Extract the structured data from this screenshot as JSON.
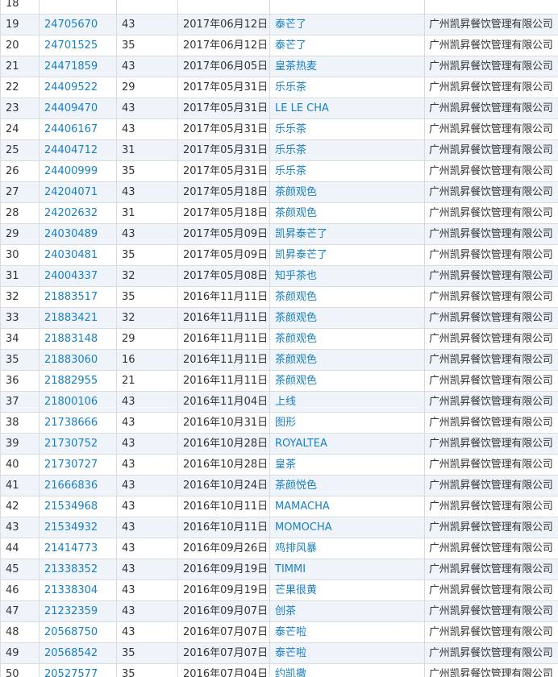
{
  "table": {
    "rows": [
      {
        "no": "18",
        "reg": "",
        "cls": "",
        "date": "",
        "name": "",
        "applicant": ""
      },
      {
        "no": "19",
        "reg": "24705670",
        "cls": "43",
        "date": "2017年06月12日",
        "name": "泰芒了",
        "applicant": "广州凯昇餐饮管理有限公司"
      },
      {
        "no": "20",
        "reg": "24701525",
        "cls": "35",
        "date": "2017年06月12日",
        "name": "泰芒了",
        "applicant": "广州凯昇餐饮管理有限公司"
      },
      {
        "no": "21",
        "reg": "24471859",
        "cls": "43",
        "date": "2017年06月05日",
        "name": "皇茶热麦",
        "applicant": "广州凯昇餐饮管理有限公司"
      },
      {
        "no": "22",
        "reg": "24409522",
        "cls": "29",
        "date": "2017年05月31日",
        "name": "乐乐茶",
        "applicant": "广州凯昇餐饮管理有限公司"
      },
      {
        "no": "23",
        "reg": "24409470",
        "cls": "43",
        "date": "2017年05月31日",
        "name": "LE LE CHA",
        "applicant": "广州凯昇餐饮管理有限公司"
      },
      {
        "no": "24",
        "reg": "24406167",
        "cls": "43",
        "date": "2017年05月31日",
        "name": "乐乐茶",
        "applicant": "广州凯昇餐饮管理有限公司"
      },
      {
        "no": "25",
        "reg": "24404712",
        "cls": "31",
        "date": "2017年05月31日",
        "name": "乐乐茶",
        "applicant": "广州凯昇餐饮管理有限公司"
      },
      {
        "no": "26",
        "reg": "24400999",
        "cls": "35",
        "date": "2017年05月31日",
        "name": "乐乐茶",
        "applicant": "广州凯昇餐饮管理有限公司"
      },
      {
        "no": "27",
        "reg": "24204071",
        "cls": "43",
        "date": "2017年05月18日",
        "name": "茶颜观色",
        "applicant": "广州凯昇餐饮管理有限公司"
      },
      {
        "no": "28",
        "reg": "24202632",
        "cls": "31",
        "date": "2017年05月18日",
        "name": "茶颜观色",
        "applicant": "广州凯昇餐饮管理有限公司"
      },
      {
        "no": "29",
        "reg": "24030489",
        "cls": "43",
        "date": "2017年05月09日",
        "name": "凯昇泰芒了",
        "applicant": "广州凯昇餐饮管理有限公司"
      },
      {
        "no": "30",
        "reg": "24030481",
        "cls": "35",
        "date": "2017年05月09日",
        "name": "凯昇泰芒了",
        "applicant": "广州凯昇餐饮管理有限公司"
      },
      {
        "no": "31",
        "reg": "24004337",
        "cls": "32",
        "date": "2017年05月08日",
        "name": "知乎茶也",
        "applicant": "广州凯昇餐饮管理有限公司"
      },
      {
        "no": "32",
        "reg": "21883517",
        "cls": "35",
        "date": "2016年11月11日",
        "name": "茶颜观色",
        "applicant": "广州凯昇餐饮管理有限公司"
      },
      {
        "no": "33",
        "reg": "21883421",
        "cls": "32",
        "date": "2016年11月11日",
        "name": "茶颜观色",
        "applicant": "广州凯昇餐饮管理有限公司"
      },
      {
        "no": "34",
        "reg": "21883148",
        "cls": "29",
        "date": "2016年11月11日",
        "name": "茶颜观色",
        "applicant": "广州凯昇餐饮管理有限公司"
      },
      {
        "no": "35",
        "reg": "21883060",
        "cls": "16",
        "date": "2016年11月11日",
        "name": "茶颜观色",
        "applicant": "广州凯昇餐饮管理有限公司"
      },
      {
        "no": "36",
        "reg": "21882955",
        "cls": "21",
        "date": "2016年11月11日",
        "name": "茶颜观色",
        "applicant": "广州凯昇餐饮管理有限公司"
      },
      {
        "no": "37",
        "reg": "21800106",
        "cls": "43",
        "date": "2016年11月04日",
        "name": "上线",
        "applicant": "广州凯昇餐饮管理有限公司"
      },
      {
        "no": "38",
        "reg": "21738666",
        "cls": "43",
        "date": "2016年10月31日",
        "name": "图形",
        "applicant": "广州凯昇餐饮管理有限公司"
      },
      {
        "no": "39",
        "reg": "21730752",
        "cls": "43",
        "date": "2016年10月28日",
        "name": "ROYALTEA",
        "applicant": "广州凯昇餐饮管理有限公司"
      },
      {
        "no": "40",
        "reg": "21730727",
        "cls": "43",
        "date": "2016年10月28日",
        "name": "皇茶",
        "applicant": "广州凯昇餐饮管理有限公司"
      },
      {
        "no": "41",
        "reg": "21666836",
        "cls": "43",
        "date": "2016年10月24日",
        "name": "茶颜悦色",
        "applicant": "广州凯昇餐饮管理有限公司"
      },
      {
        "no": "42",
        "reg": "21534968",
        "cls": "43",
        "date": "2016年10月11日",
        "name": "MAMACHA",
        "applicant": "广州凯昇餐饮管理有限公司"
      },
      {
        "no": "43",
        "reg": "21534932",
        "cls": "43",
        "date": "2016年10月11日",
        "name": "MOMOCHA",
        "applicant": "广州凯昇餐饮管理有限公司"
      },
      {
        "no": "44",
        "reg": "21414773",
        "cls": "43",
        "date": "2016年09月26日",
        "name": "鸡排风暴",
        "applicant": "广州凯昇餐饮管理有限公司"
      },
      {
        "no": "45",
        "reg": "21338352",
        "cls": "43",
        "date": "2016年09月19日",
        "name": "TIMMI",
        "applicant": "广州凯昇餐饮管理有限公司"
      },
      {
        "no": "46",
        "reg": "21338304",
        "cls": "43",
        "date": "2016年09月19日",
        "name": "芒果很黄",
        "applicant": "广州凯昇餐饮管理有限公司"
      },
      {
        "no": "47",
        "reg": "21232359",
        "cls": "43",
        "date": "2016年09月07日",
        "name": "创茶",
        "applicant": "广州凯昇餐饮管理有限公司"
      },
      {
        "no": "48",
        "reg": "20568750",
        "cls": "43",
        "date": "2016年07月07日",
        "name": "泰芒啦",
        "applicant": "广州凯昇餐饮管理有限公司"
      },
      {
        "no": "49",
        "reg": "20568542",
        "cls": "35",
        "date": "2016年07月07日",
        "name": "泰芒啦",
        "applicant": "广州凯昇餐饮管理有限公司"
      },
      {
        "no": "50",
        "reg": "20527577",
        "cls": "35",
        "date": "2016年07月04日",
        "name": "约凯撒",
        "applicant": "广州凯昇餐饮管理有限公司"
      }
    ]
  }
}
